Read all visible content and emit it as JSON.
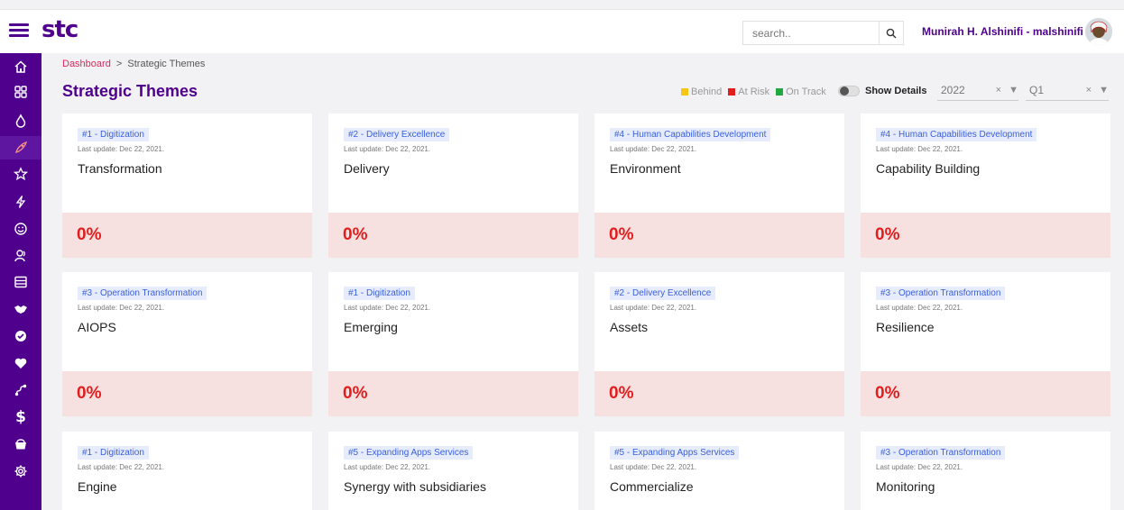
{
  "app": {
    "logo": "stc"
  },
  "search": {
    "placeholder": "search.."
  },
  "user": {
    "name": "Munirah H. Alshinifi - malshinifi"
  },
  "sidebar": {
    "items": [
      {
        "icon": "home-icon"
      },
      {
        "icon": "grid-icon"
      },
      {
        "icon": "drop-icon"
      },
      {
        "icon": "rocket-icon"
      },
      {
        "icon": "star-icon"
      },
      {
        "icon": "bolt-icon"
      },
      {
        "icon": "smiley-icon"
      },
      {
        "icon": "users-icon"
      },
      {
        "icon": "list-icon"
      },
      {
        "icon": "handshake-icon"
      },
      {
        "icon": "check-circle-icon"
      },
      {
        "icon": "heart-icon"
      },
      {
        "icon": "route-icon"
      },
      {
        "icon": "dollar-icon"
      },
      {
        "icon": "basket-icon"
      },
      {
        "icon": "settings-icon"
      }
    ]
  },
  "breadcrumb": {
    "home": "Dashboard",
    "separator": ">",
    "current": "Strategic Themes"
  },
  "page": {
    "title": "Strategic Themes"
  },
  "legend": [
    {
      "label": "Behind",
      "color": "#f5c518"
    },
    {
      "label": "At Risk",
      "color": "#e01e1e"
    },
    {
      "label": "On Track",
      "color": "#1fa83f"
    }
  ],
  "filters": {
    "show_details_label": "Show Details",
    "year": "2022",
    "quarter": "Q1",
    "clear": "×",
    "arrow": "▼"
  },
  "colors": {
    "brand": "#4f008c",
    "danger": "#e01e1e",
    "tag_bg": "#e6ecfc",
    "tag_text": "#3a5fd8",
    "foot_bg": "#f7e0e0"
  },
  "cards": [
    {
      "tag": "#1 - Digitization",
      "updated": "Last update: Dec 22, 2021.",
      "name": "Transformation",
      "percent": "0%"
    },
    {
      "tag": "#2 - Delivery Excellence",
      "updated": "Last update: Dec 22, 2021.",
      "name": "Delivery",
      "percent": "0%"
    },
    {
      "tag": "#4 - Human Capabilities Development",
      "updated": "Last update: Dec 22, 2021.",
      "name": "Environment",
      "percent": "0%"
    },
    {
      "tag": "#4 - Human Capabilities Development",
      "updated": "Last update: Dec 22, 2021.",
      "name": "Capability Building",
      "percent": "0%"
    },
    {
      "tag": "#3 - Operation Transformation",
      "updated": "Last update: Dec 22, 2021.",
      "name": "AIOPS",
      "percent": "0%"
    },
    {
      "tag": "#1 - Digitization",
      "updated": "Last update: Dec 22, 2021.",
      "name": "Emerging",
      "percent": "0%"
    },
    {
      "tag": "#2 - Delivery Excellence",
      "updated": "Last update: Dec 22, 2021.",
      "name": "Assets",
      "percent": "0%"
    },
    {
      "tag": "#3 - Operation Transformation",
      "updated": "Last update: Dec 22, 2021.",
      "name": "Resilience",
      "percent": "0%"
    },
    {
      "tag": "#1 - Digitization",
      "updated": "Last update: Dec 22, 2021.",
      "name": "Engine"
    },
    {
      "tag": "#5 - Expanding Apps Services",
      "updated": "Last update: Dec 22, 2021.",
      "name": "Synergy with subsidiaries"
    },
    {
      "tag": "#5 - Expanding Apps Services",
      "updated": "Last update: Dec 22, 2021.",
      "name": "Commercialize"
    },
    {
      "tag": "#3 - Operation Transformation",
      "updated": "Last update: Dec 22, 2021.",
      "name": "Monitoring"
    }
  ]
}
